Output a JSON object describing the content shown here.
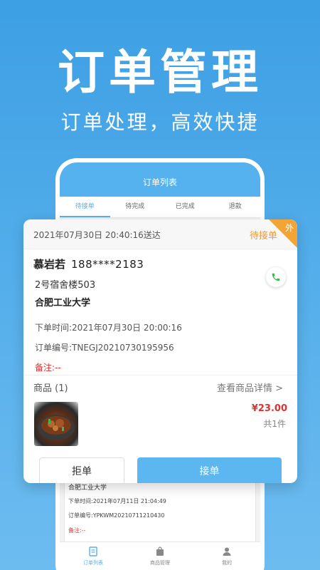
{
  "hero": {
    "title": "订单管理",
    "subtitle": "订单处理，高效快捷"
  },
  "phone": {
    "header_title": "订单列表",
    "tabs": [
      {
        "label": "待接单",
        "active": true
      },
      {
        "label": "待完成",
        "active": false
      },
      {
        "label": "已完成",
        "active": false
      },
      {
        "label": "退款",
        "active": false
      }
    ],
    "background_order": {
      "location": "合肥工业大学",
      "order_time": "下单时间:2021年07月11日 21:04:49",
      "order_no": "订单编号:YPKWM20210711210430",
      "remark": "备注:--"
    },
    "bottom_nav": [
      {
        "label": "订单列表",
        "icon": "order-list-icon",
        "active": true
      },
      {
        "label": "商品管理",
        "icon": "bag-icon",
        "active": false
      },
      {
        "label": "我的",
        "icon": "user-icon",
        "active": false
      }
    ]
  },
  "order": {
    "deliver_time": "2021年07月30日 20:40:16送达",
    "status": "待接单",
    "corner_badge": "外",
    "customer_name": "慕岩若",
    "customer_phone": "188****2183",
    "address": "2号宿舍楼503",
    "school": "合肥工业大学",
    "order_time": "下单时间:2021年07月30日 20:00:16",
    "order_no": "订单编号:TNEGJ20210730195956",
    "remark": "备注:--",
    "goods_title": "商品 (1)",
    "goods_link": "查看商品详情 >",
    "price": "¥23.00",
    "quantity": "共1件",
    "reject_label": "拒单",
    "accept_label": "接单"
  },
  "colors": {
    "brand_blue": "#56b2ee",
    "status_orange": "#f2992e",
    "price_red": "#e0312f",
    "call_green": "#2cc13c"
  }
}
